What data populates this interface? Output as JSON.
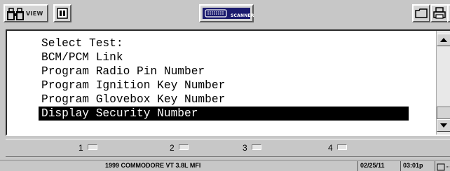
{
  "toolbar": {
    "view_label": "VIEW",
    "scanner_label": "SCANNER"
  },
  "screen": {
    "title": "Select Test:",
    "items": [
      "BCM/PCM Link",
      "Program Radio Pin Number",
      "Program Ignition Key Number",
      "Program Glovebox Key Number",
      "Display Security Number"
    ],
    "selected_index": 4
  },
  "function_keys": [
    "1",
    "2",
    "3",
    "4"
  ],
  "status_bar": {
    "vehicle": "1999 COMMODORE VT 3.8L MFI",
    "date": "02/25/11",
    "time": "03:01p"
  }
}
